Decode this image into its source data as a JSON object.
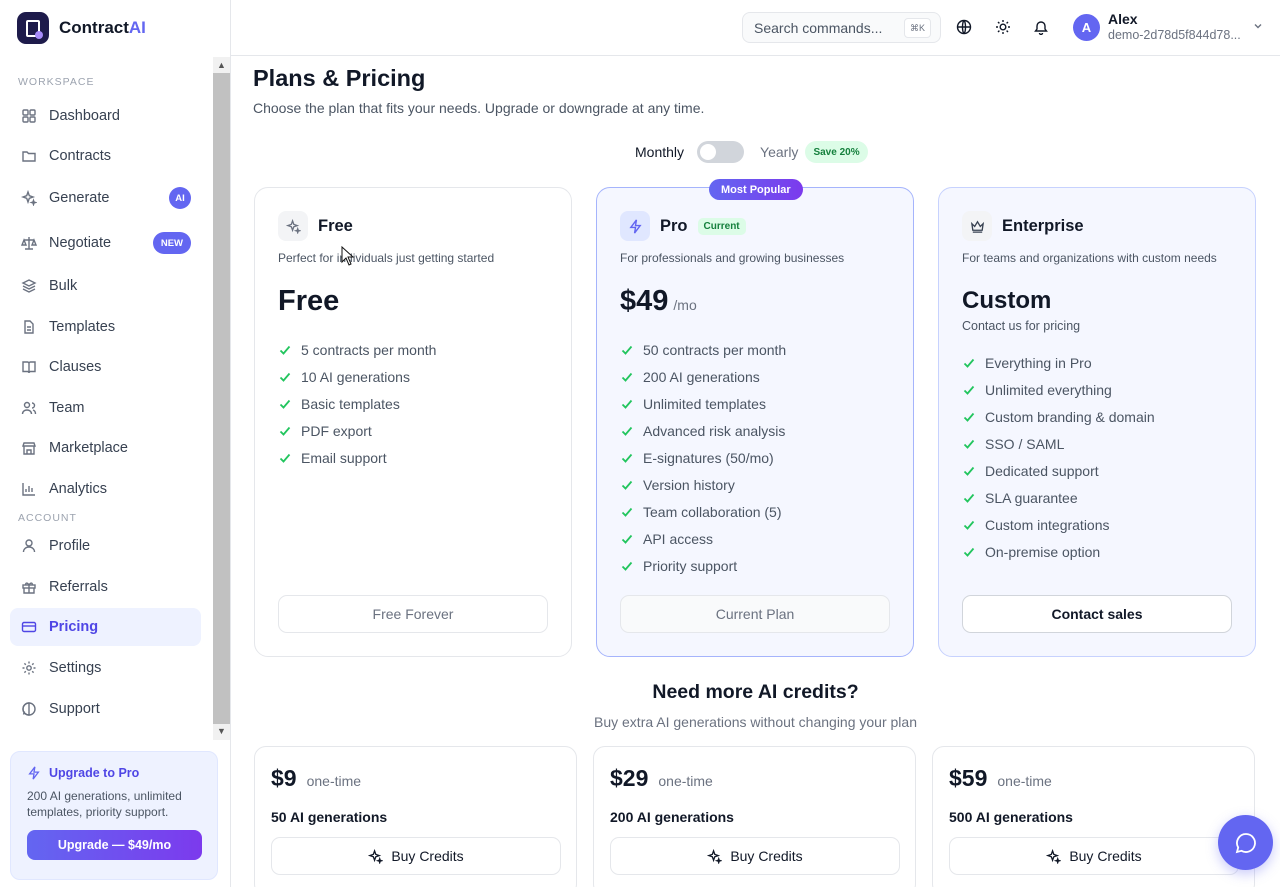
{
  "brand": {
    "name_main": "Contract",
    "name_accent": "AI"
  },
  "header": {
    "search_placeholder": "Search commands...",
    "search_shortcut": "⌘K",
    "user_initial": "A",
    "user_name": "Alex",
    "user_id": "demo-2d78d5f844d78..."
  },
  "sidebar": {
    "workspace_label": "WORKSPACE",
    "account_label": "ACCOUNT",
    "items": [
      {
        "label": "Dashboard",
        "icon": "grid-icon"
      },
      {
        "label": "Contracts",
        "icon": "folder-icon"
      },
      {
        "label": "Generate",
        "icon": "sparkles-icon",
        "badge": "AI"
      },
      {
        "label": "Negotiate",
        "icon": "scale-icon",
        "badge": "NEW"
      },
      {
        "label": "Bulk",
        "icon": "layers-icon"
      },
      {
        "label": "Templates",
        "icon": "file-icon"
      },
      {
        "label": "Clauses",
        "icon": "book-icon"
      },
      {
        "label": "Team",
        "icon": "users-icon"
      },
      {
        "label": "Marketplace",
        "icon": "store-icon"
      },
      {
        "label": "Analytics",
        "icon": "bar-chart-icon"
      }
    ],
    "account_items": [
      {
        "label": "Profile",
        "icon": "user-icon"
      },
      {
        "label": "Referrals",
        "icon": "gift-icon"
      },
      {
        "label": "Pricing",
        "icon": "credit-card-icon",
        "active": true
      },
      {
        "label": "Settings",
        "icon": "gear-icon"
      },
      {
        "label": "Support",
        "icon": "message-icon"
      }
    ],
    "upgrade": {
      "title": "Upgrade to Pro",
      "text": "200 AI generations, unlimited templates, priority support.",
      "button": "Upgrade — $49/mo"
    }
  },
  "main": {
    "title": "Plans & Pricing",
    "subtitle": "Choose the plan that fits your needs. Upgrade or downgrade at any time.",
    "billing": {
      "monthly": "Monthly",
      "yearly": "Yearly",
      "save_badge": "Save 20%",
      "yearly_selected": false
    },
    "plans": [
      {
        "name": "Free",
        "desc": "Perfect for individuals just getting started",
        "price": "Free",
        "features": [
          "5 contracts per month",
          "10 AI generations",
          "Basic templates",
          "PDF export",
          "Email support"
        ],
        "button": "Free Forever"
      },
      {
        "name": "Pro",
        "popular_badge": "Most Popular",
        "current_badge": "Current",
        "desc": "For professionals and growing businesses",
        "price": "$49",
        "price_unit": "/mo",
        "features": [
          "50 contracts per month",
          "200 AI generations",
          "Unlimited templates",
          "Advanced risk analysis",
          "E-signatures (50/mo)",
          "Version history",
          "Team collaboration (5)",
          "API access",
          "Priority support"
        ],
        "button": "Current Plan"
      },
      {
        "name": "Enterprise",
        "desc": "For teams and organizations with custom needs",
        "price": "Custom",
        "price_note": "Contact us for pricing",
        "features": [
          "Everything in Pro",
          "Unlimited everything",
          "Custom branding & domain",
          "SSO / SAML",
          "Dedicated support",
          "SLA guarantee",
          "Custom integrations",
          "On-premise option"
        ],
        "button": "Contact sales"
      }
    ],
    "credits": {
      "title": "Need more AI credits?",
      "subtitle": "Buy extra AI generations without changing your plan",
      "packs": [
        {
          "price": "$9",
          "type": "one-time",
          "generations": "50 AI generations",
          "button": "Buy Credits"
        },
        {
          "price": "$29",
          "type": "one-time",
          "generations": "200 AI generations",
          "button": "Buy Credits"
        },
        {
          "price": "$59",
          "type": "one-time",
          "generations": "500 AI generations",
          "button": "Buy Credits"
        }
      ]
    }
  },
  "colors": {
    "accent": "#6366f1",
    "check": "#22c55e",
    "active_bg": "#eef2ff"
  }
}
